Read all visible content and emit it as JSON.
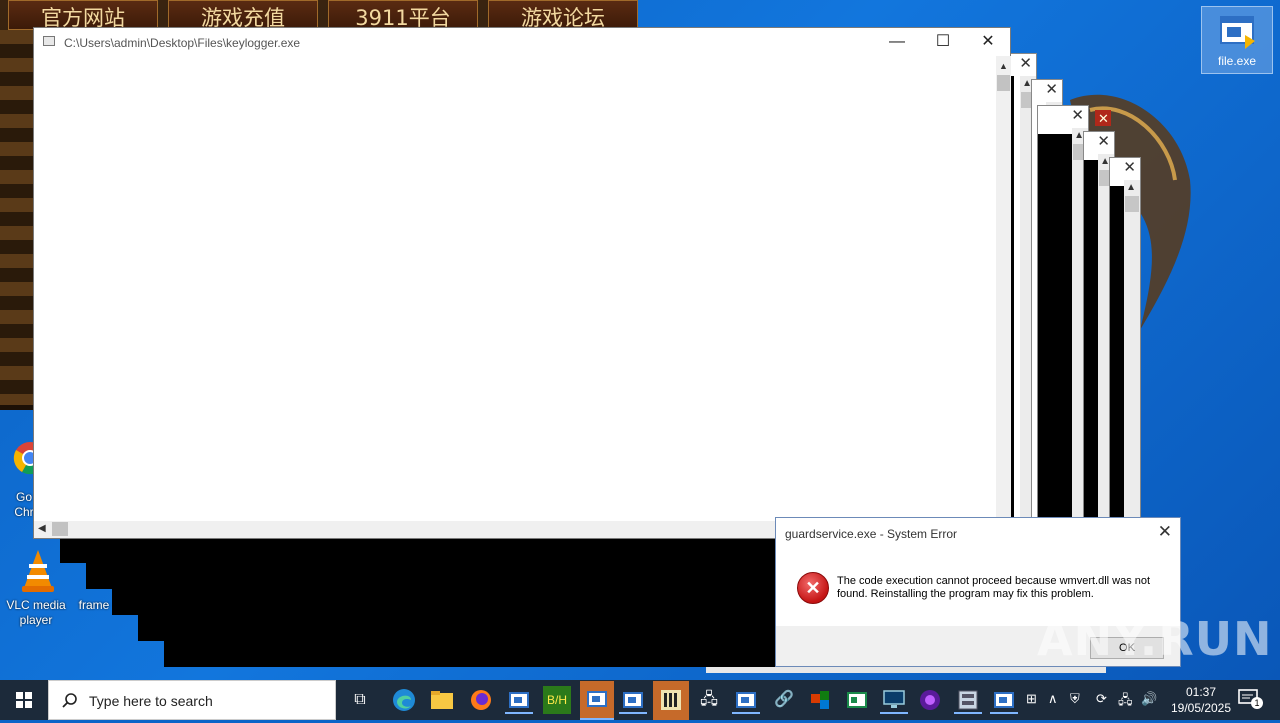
{
  "banner": {
    "buttons": [
      "官方网站",
      "游戏充值",
      "3911平台",
      "游戏论坛"
    ]
  },
  "desktop": {
    "file_icon_label": "file.exe",
    "chrome_label_1": "Go",
    "chrome_label_2": "Chr",
    "vlc_label": "VLC media player",
    "frame_label": "frame"
  },
  "main_window": {
    "title": "C:\\Users\\admin\\Desktop\\Files\\keylogger.exe",
    "minimize": "—",
    "maximize": "☐",
    "close": "✕"
  },
  "error_dialog": {
    "title": "guardservice.exe - System Error",
    "close": "✕",
    "message": "The code execution cannot proceed because wmvert.dll was not found. Reinstalling the program may fix this problem.",
    "ok_label": "OK"
  },
  "watermark": "ANY.RUN",
  "taskbar": {
    "search_placeholder": "Type here to search",
    "time": "01:37",
    "date": "19/05/2025",
    "notification_count": "1"
  },
  "colors": {
    "desktop_blue": "#0b5fc0",
    "taskbar": "#1c2a3a",
    "error_red": "#c41414"
  }
}
